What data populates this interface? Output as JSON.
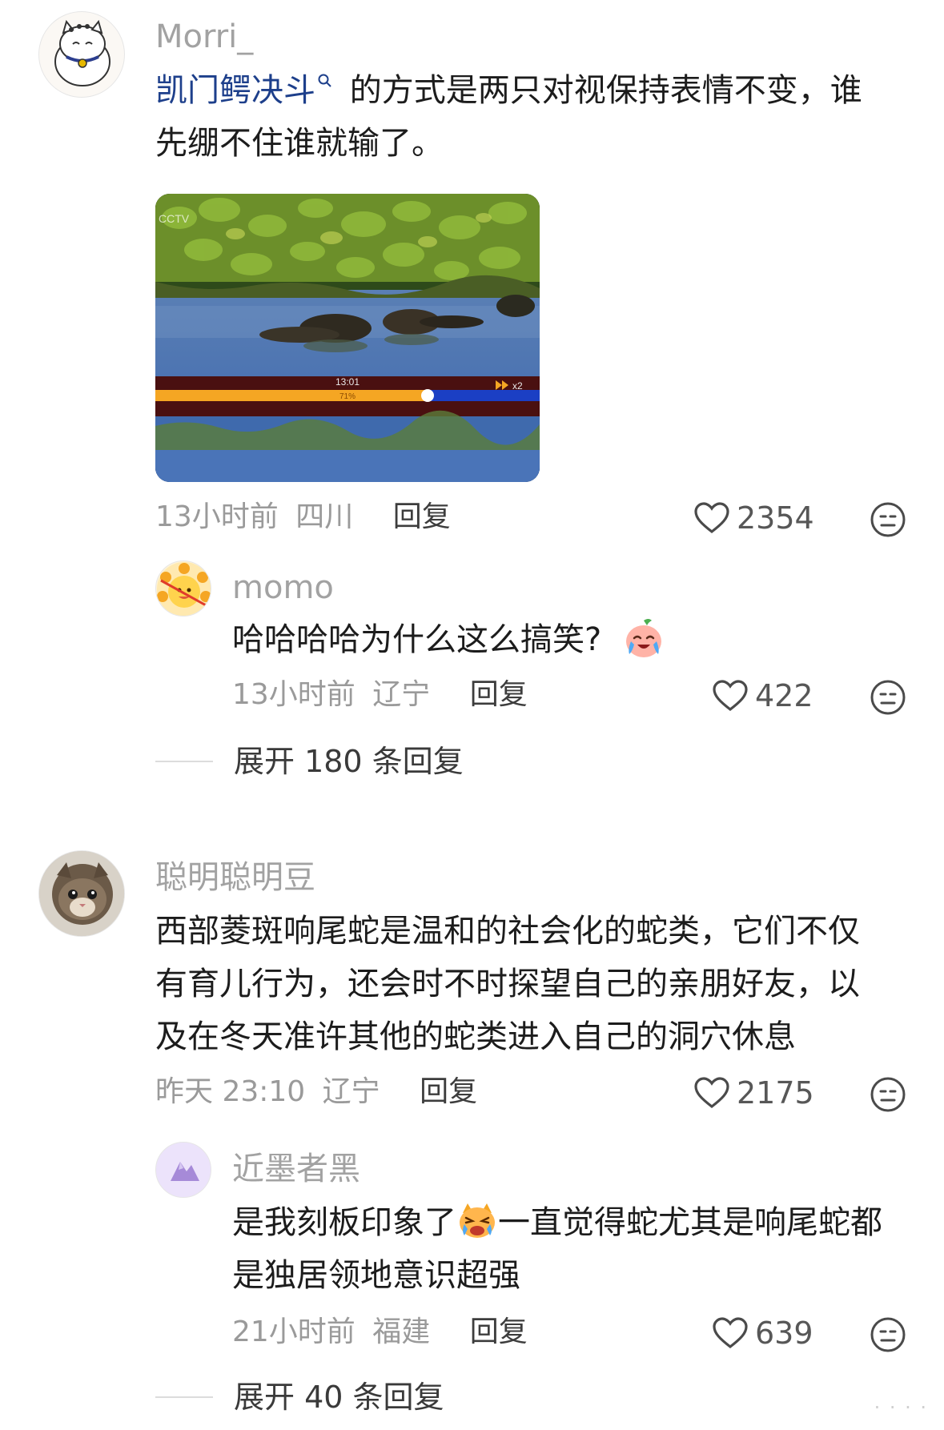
{
  "comments": [
    {
      "author": "Morri_",
      "text_link": "凯门鳄决斗",
      "text_rest_line1": "的方式是两只对视保持表情不变，谁",
      "text_line2": "先绷不住谁就输了。",
      "time": "13小时前",
      "location": "四川",
      "reply_label": "回复",
      "likes": "2354",
      "video": {
        "time": "13:01",
        "speed": "x2",
        "progress_label": "71%",
        "progress": 0.71
      },
      "replies": [
        {
          "author": "momo",
          "text": "哈哈哈哈为什么这么搞笑?",
          "emoji": "crying-laughing-peach-emoji",
          "time": "13小时前",
          "location": "辽宁",
          "reply_label": "回复",
          "likes": "422"
        }
      ],
      "expand_label": "展开 180 条回复"
    },
    {
      "author": "聪明聪明豆",
      "text_line1": "西部菱斑响尾蛇是温和的社会化的蛇类，它们不仅",
      "text_line2": "有育儿行为，还会时不时探望自己的亲朋好友，以",
      "text_line3": "及在冬天准许其他的蛇类进入自己的洞穴休息",
      "time": "昨天 23:10",
      "location": "辽宁",
      "reply_label": "回复",
      "likes": "2175",
      "replies": [
        {
          "author": "近墨者黑",
          "text_part1": "是我刻板印象了",
          "emoji": "crying-cat-emoji",
          "text_part2": "一直觉得蛇尤其是响尾蛇都",
          "text_line2": "是独居领地意识超强",
          "time": "21小时前",
          "location": "福建",
          "reply_label": "回复",
          "likes": "639"
        }
      ],
      "expand_label": "展开 40 条回复"
    }
  ],
  "icons": {
    "like": "heart-outline-icon",
    "dislike": "neutral-face-icon",
    "search": "search-superscript-icon"
  },
  "colors": {
    "link": "#1d3f8b",
    "progress_fill": "#f5a623",
    "progress_remaining": "#1b3fc4"
  }
}
